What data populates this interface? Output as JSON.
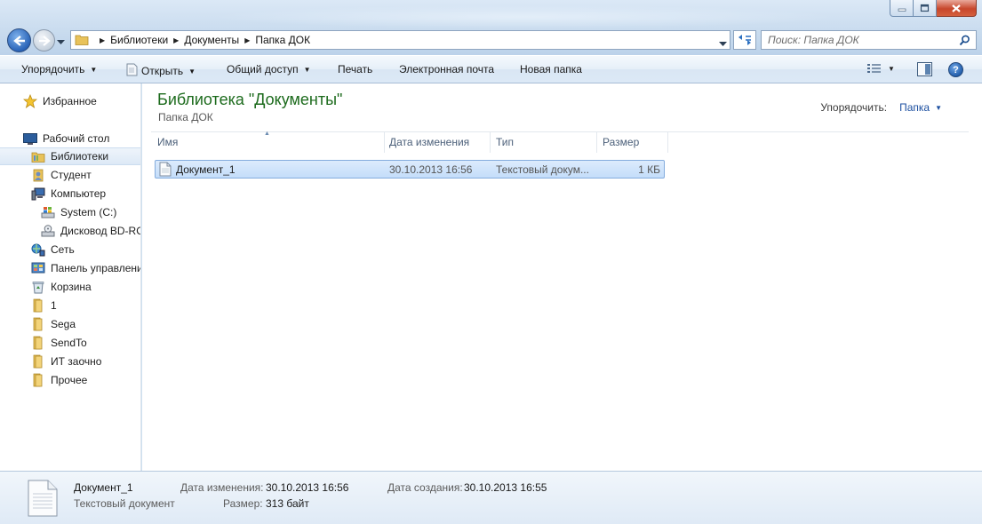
{
  "window": {
    "title": ""
  },
  "address": {
    "crumbs": [
      "Библиотеки",
      "Документы",
      "Папка ДОК"
    ]
  },
  "search": {
    "placeholder": "Поиск: Папка ДОК"
  },
  "toolbar": {
    "organize": "Упорядочить",
    "open": "Открыть",
    "share": "Общий доступ",
    "print": "Печать",
    "email": "Электронная почта",
    "new_folder": "Новая папка",
    "help": "?"
  },
  "nav": {
    "favorites": "Избранное",
    "desktop": "Рабочий стол",
    "items": [
      {
        "label": "Библиотеки",
        "icon": "libraries-icon",
        "selected": true
      },
      {
        "label": "Студент",
        "icon": "user-folder-icon"
      },
      {
        "label": "Компьютер",
        "icon": "computer-icon"
      },
      {
        "label": "System (C:)",
        "icon": "drive-icon"
      },
      {
        "label": "Дисковод BD-RC",
        "icon": "optical-drive-icon"
      },
      {
        "label": "Сеть",
        "icon": "network-icon"
      },
      {
        "label": "Панель управлени",
        "icon": "control-panel-icon"
      },
      {
        "label": "Корзина",
        "icon": "recycle-bin-icon"
      },
      {
        "label": "1",
        "icon": "folder-icon"
      },
      {
        "label": "Sega",
        "icon": "folder-icon"
      },
      {
        "label": "SendTo",
        "icon": "folder-icon"
      },
      {
        "label": "ИТ заочно",
        "icon": "folder-icon"
      },
      {
        "label": "Прочее",
        "icon": "folder-icon"
      }
    ]
  },
  "library": {
    "title": "Библиотека \"Документы\"",
    "subtitle": "Папка ДОК",
    "arrange_label": "Упорядочить:",
    "arrange_value": "Папка"
  },
  "columns": [
    "Имя",
    "Дата изменения",
    "Тип",
    "Размер"
  ],
  "files": [
    {
      "name": "Документ_1",
      "modified": "30.10.2013 16:56",
      "type": "Текстовый докум...",
      "size": "1 КБ"
    }
  ],
  "details": {
    "name": "Документ_1",
    "type": "Текстовый документ",
    "modified_label": "Дата изменения:",
    "modified_value": "30.10.2013 16:56",
    "size_label": "Размер:",
    "size_value": "313 байт",
    "created_label": "Дата создания:",
    "created_value": "30.10.2013 16:55"
  },
  "colors": {
    "title_green": "#1d6b1d",
    "accent_blue": "#1c4fa0",
    "selection": "#c4ddfa"
  }
}
